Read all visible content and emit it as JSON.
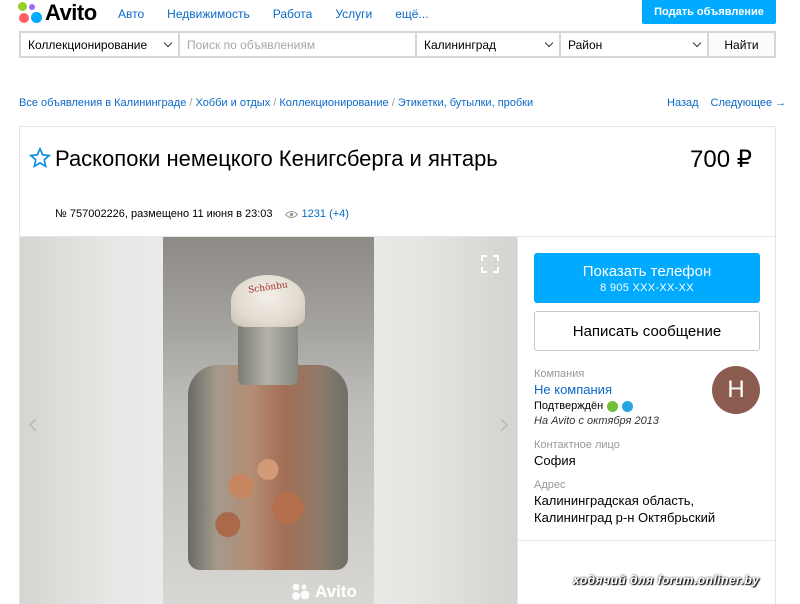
{
  "header": {
    "logo_text": "Avito",
    "logo_colors": [
      "#97cf26",
      "#a169f7",
      "#ff6163",
      "#0af"
    ],
    "nav": [
      "Авто",
      "Недвижимость",
      "Работа",
      "Услуги",
      "ещё..."
    ],
    "post_button": "Подать объявление"
  },
  "search": {
    "category": "Коллекционирование",
    "placeholder": "Поиск по объявлениям",
    "city": "Калининград",
    "district": "Район",
    "button": "Найти"
  },
  "breadcrumb": {
    "items": [
      "Все объявления в Калининграде",
      "Хобби и отдых",
      "Коллекционирование",
      "Этикетки, бутылки, пробки"
    ],
    "separator": " / ",
    "back": "Назад",
    "next": "Следующее →"
  },
  "listing": {
    "title": "Раскопоки немецкого Кенигсберга и янтарь",
    "price": "700 ₽",
    "meta": "№ 757002226, размещено 11 июня в 23:03",
    "views": "1231 (+4)",
    "photo_cap_text": "Schönbu",
    "watermark": "Avito"
  },
  "seller": {
    "phone_label": "Показать телефон",
    "phone_number": "8 905 XXX-XX-XX",
    "message_label": "Написать сообщение",
    "company_label": "Компания",
    "company_value": "Не компания",
    "confirmed": "Подтверждён",
    "since": "На Avito с октября 2013",
    "avatar_letter": "Н",
    "contact_label": "Контактное лицо",
    "contact_value": "София",
    "address_label": "Адрес",
    "address_line1": "Калининградская область,",
    "address_line2": "Калининград р-н Октябрьский"
  },
  "overlay": {
    "forum_text": "ходячий для forum.onliner.by"
  },
  "colors": {
    "accent": "#00aaff",
    "link": "#0a69c7",
    "avatar": "#8b5b4f"
  }
}
